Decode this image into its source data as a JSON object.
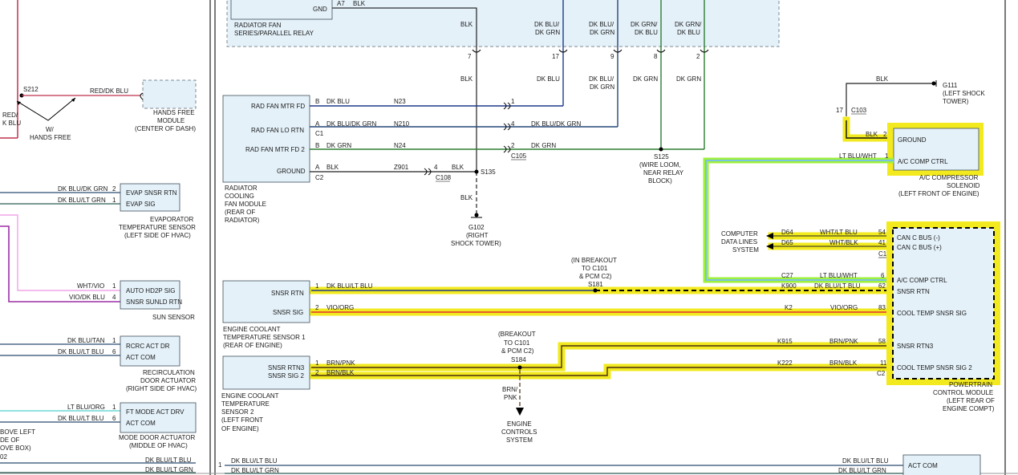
{
  "relay": {
    "pin": "GND",
    "pin_num": "A7",
    "wire": "BLK",
    "label1": "RADIATOR FAN",
    "label2": "SERIES/PARALLEL RELAY"
  },
  "top_wires": [
    {
      "c1": "BLK",
      "c2": "",
      "pin": "7"
    },
    {
      "c1": "DK BLU/",
      "c2": "DK GRN",
      "pin": "17"
    },
    {
      "c1": "DK BLU/",
      "c2": "DK GRN",
      "pin": "9"
    },
    {
      "c1": "DK GRN/",
      "c2": "DK BLU",
      "pin": "8"
    },
    {
      "c1": "DK GRN/",
      "c2": "DK BLU",
      "pin": "2"
    }
  ],
  "mid_wires": {
    "w1": "BLK",
    "w2": "DK BLU",
    "w3a": "DK BLU/",
    "w3b": "DK GRN",
    "w4": "DK GRN",
    "w5": "DK GRN",
    "blk2": "BLK",
    "blk3": "BLK"
  },
  "s212": {
    "label": "S212",
    "wire": "RED/DK BLU",
    "left_a": "RED/",
    "left_b": "K BLU",
    "w_a": "W/",
    "w_b": "HANDS FREE"
  },
  "hands_free": {
    "l1": "HANDS FREE",
    "l2": "MODULE",
    "l3": "(CENTER OF DASH)"
  },
  "fan_module": {
    "pins": [
      "RAD FAN MTR FD",
      "RAD FAN LO RTN",
      "RAD FAN MTR FD 2",
      "GROUND"
    ],
    "rows": [
      {
        "cav": "B",
        "color": "DK BLU",
        "circuit": "N23",
        "pin": "1",
        "color2": ""
      },
      {
        "cav": "A",
        "color": "DK BLU/DK GRN",
        "circuit": "N210",
        "pin": "4",
        "color2": "DK BLU/DK GRN"
      },
      {
        "cav": "B",
        "color": "DK GRN",
        "circuit": "N24",
        "pin": "2",
        "color2": "DK GRN"
      },
      {
        "cav": "A",
        "color": "BLK",
        "circuit": "Z901",
        "pin": "4",
        "color2": "BLK"
      }
    ],
    "c1": "C1",
    "c2": "C2",
    "c105": "C105",
    "c108": "C108",
    "label": [
      "RADIATOR",
      "COOLING",
      "FAN MODULE",
      "(REAR OF",
      "RADIATOR)"
    ]
  },
  "s135": "S135",
  "g102": [
    "G102",
    "(RIGHT",
    "SHOCK TOWER)"
  ],
  "s125": [
    "S125",
    "(WIRE LOOM,",
    "NEAR RELAY",
    "BLOCK)"
  ],
  "g111": {
    "wire": "BLK",
    "l1": "G111",
    "l2": "(LEFT SHOCK",
    "l3": "TOWER)",
    "pin": "17",
    "conn": "C103"
  },
  "ac_solenoid": {
    "pins": [
      "GROUND",
      "A/C COMP CTRL"
    ],
    "w1": "BLK",
    "p1": "2",
    "w2": "LT BLU/WHT",
    "p2": "1",
    "l1": "A/C COMPRESSOR",
    "l2": "SOLENOID",
    "l3": "(LEFT FRONT OF ENGINE)"
  },
  "evap": {
    "w1": "DK BLU/DK GRN",
    "p1": "2",
    "w2": "DK BLU/LT GRN",
    "p2": "1",
    "pins": [
      "EVAP SNSR RTN",
      "EVAP SIG"
    ],
    "l1": "EVAPORATOR",
    "l2": "TEMPERATURE SENSOR",
    "l3": "(LEFT SIDE OF HVAC)"
  },
  "sun": {
    "w1": "WHT/VIO",
    "p1": "1",
    "w2": "VIO/DK BLU",
    "p2": "4",
    "pins": [
      "AUTO HD2P SIG",
      "SNSR SUNLD RTN"
    ],
    "l1": "SUN SENSOR"
  },
  "recirc": {
    "w1": "DK BLU/TAN",
    "p1": "1",
    "w2": "DK BLU/LT BLU",
    "p2": "6",
    "pins": [
      "RCRC ACT DR",
      "ACT COM"
    ],
    "l1": "RECIRCULATION",
    "l2": "DOOR ACTUATOR",
    "l3": "(RIGHT SIDE OF HVAC)"
  },
  "mode": {
    "w1": "LT BLU/ORG",
    "p1": "1",
    "w2": "DK BLU/LT BLU",
    "p2": "6",
    "pins": [
      "FT MODE ACT DRV",
      "ACT COM"
    ],
    "l1": "MODE DOOR ACTUATOR",
    "l2": "(MIDDLE OF HVAC)"
  },
  "left_cut": [
    "BOVE LEFT",
    "DE OF",
    "OVE BOX)",
    "02"
  ],
  "ect1": {
    "pins": [
      "SNSR RTN",
      "SNSR SIG"
    ],
    "rows": [
      {
        "p": "1",
        "w": "DK BLU/LT BLU"
      },
      {
        "p": "2",
        "w": "VIO/ORG"
      }
    ],
    "l1": "ENGINE COOLANT",
    "l2": "TEMPERATURE SENSOR 1",
    "l3": "(REAR OF ENGINE)"
  },
  "s181": {
    "l1": "(IN BREAKOUT",
    "l2": "TO C101",
    "l3": "& PCM C2)",
    "l4": "S181"
  },
  "ect2": {
    "pins": [
      "SNSR RTN3",
      "SNSR SIG 2"
    ],
    "rows": [
      {
        "p": "1",
        "w": "BRN/PNK"
      },
      {
        "p": "2",
        "w": "BRN/BLK"
      }
    ],
    "l1": "ENGINE COOLANT",
    "l2": "TEMPERATURE",
    "l3": "SENSOR 2",
    "l4": "(LEFT FRONT",
    "l5": "OF ENGINE)"
  },
  "s184": {
    "l1": "(BREAKOUT",
    "l2": "TO C101",
    "l3": "& PCM C2)",
    "l4": "S184",
    "w_a": "BRN/",
    "w_b": "PNK"
  },
  "engine_ctrl": [
    "ENGINE",
    "CONTROLS",
    "SYSTEM"
  ],
  "computer": {
    "l1": "COMPUTER",
    "l2": "DATA LINES",
    "l3": "SYSTEM"
  },
  "pcm": {
    "pins": [
      "CAN C BUS (-)",
      "CAN C BUS (+)",
      "A/C COMP CTRL",
      "SNSR RTN",
      "COOL TEMP SNSR SIG",
      "SNSR RTN3",
      "COOL TEMP SNSR SIG 2"
    ],
    "rows": [
      {
        "circ": "D64",
        "w": "WHT/LT BLU",
        "p": "54"
      },
      {
        "circ": "D65",
        "w": "WHT/BLK",
        "p": "41"
      },
      {
        "circ": "C27",
        "w": "LT BLU/WHT",
        "p": "6"
      },
      {
        "circ": "K900",
        "w": "DK BLU/LT BLU",
        "p": "62"
      },
      {
        "circ": "K2",
        "w": "VIO/ORG",
        "p": "83"
      },
      {
        "circ": "K915",
        "w": "BRN/PNK",
        "p": "58"
      },
      {
        "circ": "K222",
        "w": "BRN/BLK",
        "p": "11"
      }
    ],
    "c1": "C1",
    "c2": "C2",
    "l1": "POWERTRAIN",
    "l2": "CONTROL MODULE",
    "l3": "(LEFT REAR OF",
    "l4": "ENGINE COMPT)"
  },
  "bottom": {
    "pin": "1",
    "w1": "DK BLU/LT BLU",
    "w2": "DK BLU/LT GRN",
    "r1": "DK BLU/LT BLU",
    "r2": "DK BLU/LT GRN",
    "act": "ACT COM",
    "left1": "DK BLU/LT BLU",
    "left2": "DK BLU/LT GRN"
  }
}
